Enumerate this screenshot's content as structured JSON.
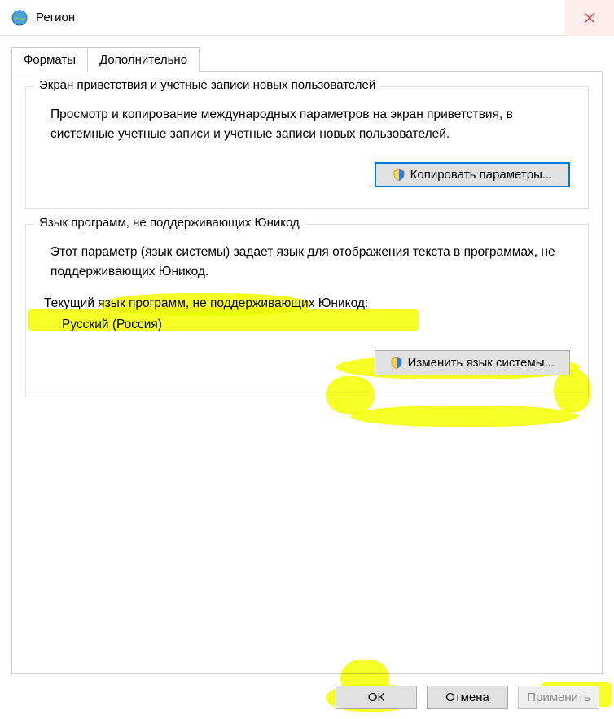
{
  "window": {
    "title": "Регион"
  },
  "tabs": {
    "formats": "Форматы",
    "additional": "Дополнительно"
  },
  "group1": {
    "legend": "Экран приветствия и учетные записи новых пользователей",
    "desc": "Просмотр и копирование международных параметров на экран приветствия, в системные учетные записи и учетные записи новых пользователей.",
    "copy_btn": "Копировать параметры..."
  },
  "group2": {
    "legend": "Язык программ, не поддерживающих Юникод",
    "desc": "Этот параметр (язык системы) задает язык для отображения текста в программах, не поддерживающих Юникод.",
    "current_label": "Текущий язык программ, не поддерживающих Юникод:",
    "current_value": "Русский (Россия)",
    "change_btn": "Изменить язык системы..."
  },
  "buttons": {
    "ok": "ОК",
    "cancel": "Отмена",
    "apply": "Применить"
  }
}
